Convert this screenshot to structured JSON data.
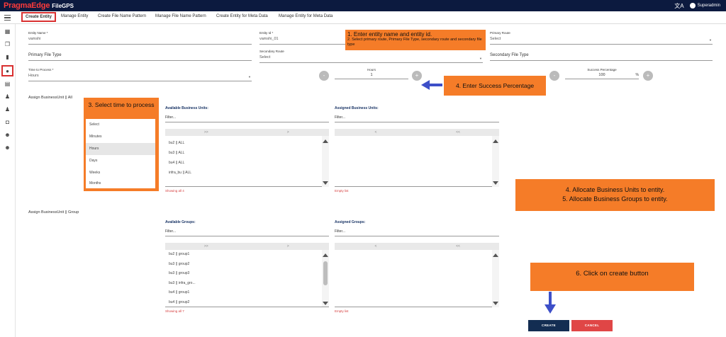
{
  "header": {
    "brand": "PragmaEdge",
    "app": "FileGPS",
    "user": "Superadmin"
  },
  "tabs": [
    {
      "label": "Create Entity"
    },
    {
      "label": "Manage Entity"
    },
    {
      "label": "Create File Name Pattern"
    },
    {
      "label": "Manage File Name Pattern"
    },
    {
      "label": "Create Entity for Meta Data"
    },
    {
      "label": "Manage Entity for Meta Data"
    }
  ],
  "form": {
    "entity_name": {
      "label": "Entity Name *",
      "value": "vamshi"
    },
    "entity_id": {
      "label": "Entity Id *",
      "value": "vamshi_01"
    },
    "primary_route": {
      "label": "Primary Route",
      "value": "Select"
    },
    "primary_file_type": {
      "value": "Primary File Type"
    },
    "secondary_route": {
      "label": "Secondary Route",
      "value": "Select"
    },
    "secondary_file_type": {
      "value": "Secondary File Type"
    },
    "time_to_process": {
      "label": "Time to Process *",
      "value": "Hours"
    },
    "hours": {
      "label": "Hours",
      "value": "1"
    },
    "success_percentage": {
      "label": "Success Percentage",
      "value": "100",
      "unit": "%"
    },
    "minus": "-",
    "plus": "+"
  },
  "callouts": {
    "c1_title": "1. Enter entity name and entity id.",
    "c1_sub": "2. Select primary route, Primary File Type, secondary route and secondary file type",
    "c3": "3. Select time to process",
    "c4": "4. Enter Success Percentage",
    "c45_line1": "4. Allocate Business Units to entity.",
    "c45_line2": "5. Allocate Business Groups to entity.",
    "c6": "6. Click on create button"
  },
  "time_options": [
    "Select",
    "Minutes",
    "Hours",
    "Days",
    "Weeks",
    "Months"
  ],
  "bu_section": {
    "label": "Assign BusinessUnit || All",
    "available_title": "Available Business Units:",
    "assigned_title": "Assigned Business Units:",
    "filter": "Filter...",
    "move_all_right": ">>",
    "move_right": ">",
    "move_left": "<",
    "move_all_left": "<<",
    "items": [
      "bu2 || ALL",
      "bu3 || ALL",
      "bu4 || ALL",
      "infra_bu || ALL"
    ],
    "available_footer": "Showing all 4",
    "assigned_footer": "Empty list"
  },
  "group_section": {
    "label": "Assign BusinessUnit || Group",
    "available_title": "Available Groups:",
    "assigned_title": "Assigned Groups:",
    "filter": "Filter...",
    "move_all_right": ">>",
    "move_right": ">",
    "move_left": "<",
    "move_all_left": "<<",
    "items": [
      "bu2 || group1",
      "bu3 || group2",
      "bu3 || group3",
      "bu3 || infra_gro...",
      "bu4 || group1",
      "bu4 || group2"
    ],
    "available_footer": "Showing all 7",
    "assigned_footer": "Empty list"
  },
  "actions": {
    "create": "CREATE",
    "cancel": "CANCEL"
  },
  "colors": {
    "accent": "#f57c28",
    "navy": "#0c1a3f",
    "create": "#132d52",
    "cancel": "#e04646",
    "highlight": "#d93030"
  }
}
